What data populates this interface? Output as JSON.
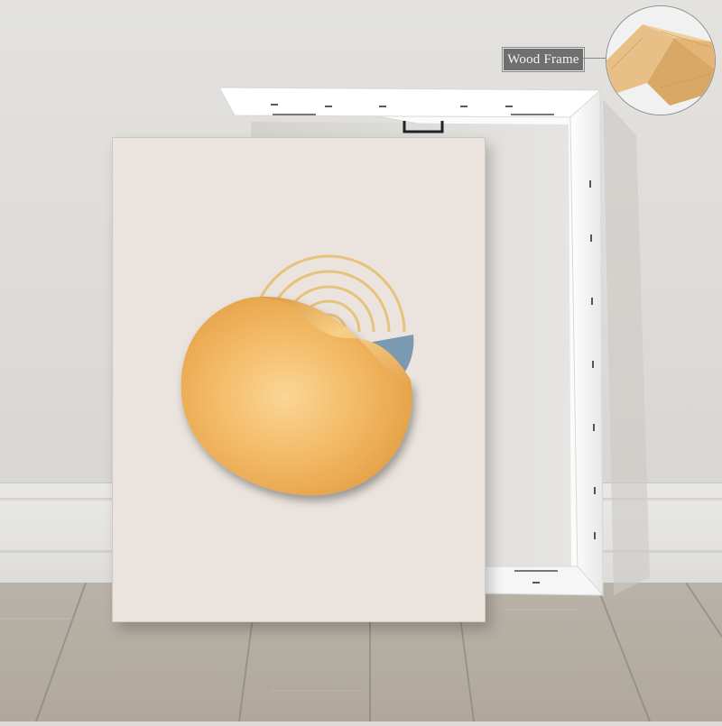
{
  "callout": {
    "label": "Wood Frame"
  },
  "colors": {
    "wall": "#e0dfdc",
    "floor": "#b4ada2",
    "canvas": "#ebe4de",
    "gold": "#f0b25e",
    "rings": "#e5bf78",
    "blue": "#7b99b1",
    "wood": "#e2b47c",
    "stretcher": "#ffffff"
  },
  "icons": [
    "wood-frame-corner-detail"
  ]
}
